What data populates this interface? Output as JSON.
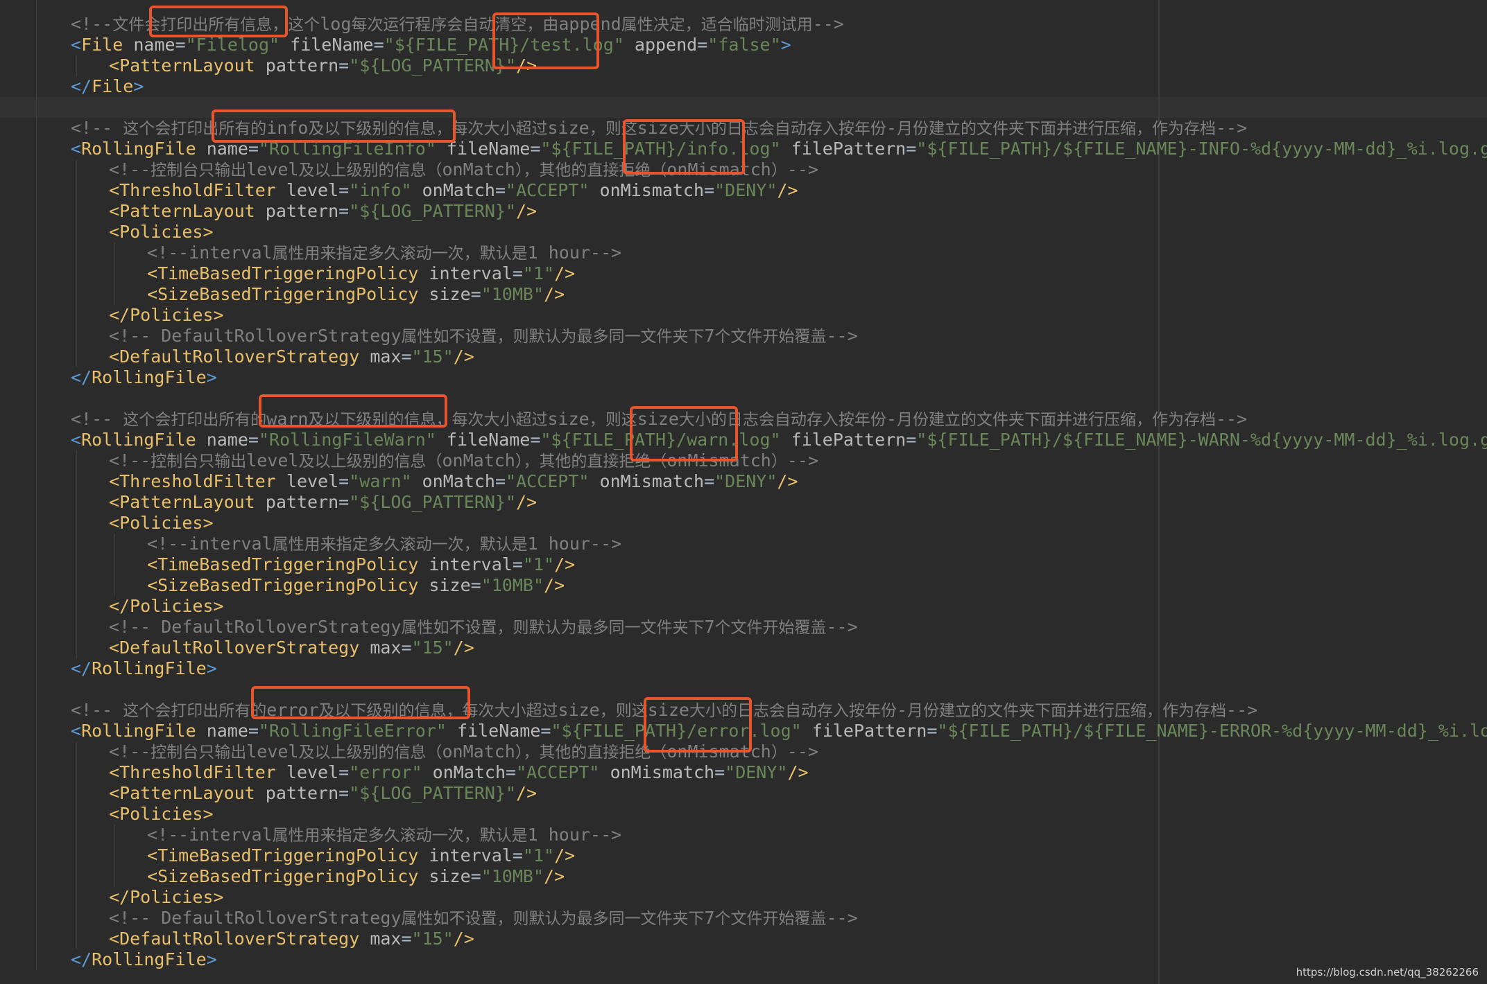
{
  "colors": {
    "background": "#2b2b2b",
    "comment": "#808080",
    "tag": "#e8bf6a",
    "attr_value": "#6a8759",
    "highlight": "#e8542c"
  },
  "code": {
    "lines": [
      {
        "kind": "comment",
        "indent": 0,
        "text": "<!--文件会打印出所有信息，这个log每次运行程序会自动清空，由append属性决定，适合临时测试用-->"
      },
      {
        "kind": "tag",
        "indent": 0,
        "text": "<File name=\"Filelog\" fileName=\"${FILE_PATH}/test.log\" append=\"false\">"
      },
      {
        "kind": "tag",
        "indent": 1,
        "text": "<PatternLayout pattern=\"${LOG_PATTERN}\"/>"
      },
      {
        "kind": "tag",
        "indent": 0,
        "text": "</File>"
      },
      {
        "kind": "blank",
        "indent": 0,
        "text": ""
      },
      {
        "kind": "comment",
        "indent": 0,
        "text": "<!-- 这个会打印出所有的info及以下级别的信息，每次大小超过size，则这size大小的日志会自动存入按年份-月份建立的文件夹下面并进行压缩，作为存档-->"
      },
      {
        "kind": "tag",
        "indent": 0,
        "text": "<RollingFile name=\"RollingFileInfo\" fileName=\"${FILE_PATH}/info.log\" filePattern=\"${FILE_PATH}/${FILE_NAME}-INFO-%d{yyyy-MM-dd}_%i.log.gz\">"
      },
      {
        "kind": "comment",
        "indent": 1,
        "text": "<!--控制台只输出level及以上级别的信息（onMatch），其他的直接拒绝（onMismatch）-->"
      },
      {
        "kind": "tag",
        "indent": 1,
        "text": "<ThresholdFilter level=\"info\" onMatch=\"ACCEPT\" onMismatch=\"DENY\"/>"
      },
      {
        "kind": "tag",
        "indent": 1,
        "text": "<PatternLayout pattern=\"${LOG_PATTERN}\"/>"
      },
      {
        "kind": "tag",
        "indent": 1,
        "text": "<Policies>"
      },
      {
        "kind": "comment",
        "indent": 2,
        "text": "<!--interval属性用来指定多久滚动一次，默认是1 hour-->"
      },
      {
        "kind": "tag",
        "indent": 2,
        "text": "<TimeBasedTriggeringPolicy interval=\"1\"/>"
      },
      {
        "kind": "tag",
        "indent": 2,
        "text": "<SizeBasedTriggeringPolicy size=\"10MB\"/>"
      },
      {
        "kind": "tag",
        "indent": 1,
        "text": "</Policies>"
      },
      {
        "kind": "comment",
        "indent": 1,
        "text": "<!-- DefaultRolloverStrategy属性如不设置，则默认为最多同一文件夹下7个文件开始覆盖-->"
      },
      {
        "kind": "tag",
        "indent": 1,
        "text": "<DefaultRolloverStrategy max=\"15\"/>"
      },
      {
        "kind": "tag",
        "indent": 0,
        "text": "</RollingFile>"
      },
      {
        "kind": "blank",
        "indent": 0,
        "text": ""
      },
      {
        "kind": "comment",
        "indent": 0,
        "text": "<!-- 这个会打印出所有的warn及以下级别的信息，每次大小超过size，则这size大小的日志会自动存入按年份-月份建立的文件夹下面并进行压缩，作为存档-->"
      },
      {
        "kind": "tag",
        "indent": 0,
        "text": "<RollingFile name=\"RollingFileWarn\" fileName=\"${FILE_PATH}/warn.log\" filePattern=\"${FILE_PATH}/${FILE_NAME}-WARN-%d{yyyy-MM-dd}_%i.log.gz\">"
      },
      {
        "kind": "comment",
        "indent": 1,
        "text": "<!--控制台只输出level及以上级别的信息（onMatch），其他的直接拒绝（onMismatch）-->"
      },
      {
        "kind": "tag",
        "indent": 1,
        "text": "<ThresholdFilter level=\"warn\" onMatch=\"ACCEPT\" onMismatch=\"DENY\"/>"
      },
      {
        "kind": "tag",
        "indent": 1,
        "text": "<PatternLayout pattern=\"${LOG_PATTERN}\"/>"
      },
      {
        "kind": "tag",
        "indent": 1,
        "text": "<Policies>"
      },
      {
        "kind": "comment",
        "indent": 2,
        "text": "<!--interval属性用来指定多久滚动一次，默认是1 hour-->"
      },
      {
        "kind": "tag",
        "indent": 2,
        "text": "<TimeBasedTriggeringPolicy interval=\"1\"/>"
      },
      {
        "kind": "tag",
        "indent": 2,
        "text": "<SizeBasedTriggeringPolicy size=\"10MB\"/>"
      },
      {
        "kind": "tag",
        "indent": 1,
        "text": "</Policies>"
      },
      {
        "kind": "comment",
        "indent": 1,
        "text": "<!-- DefaultRolloverStrategy属性如不设置，则默认为最多同一文件夹下7个文件开始覆盖-->"
      },
      {
        "kind": "tag",
        "indent": 1,
        "text": "<DefaultRolloverStrategy max=\"15\"/>"
      },
      {
        "kind": "tag",
        "indent": 0,
        "text": "</RollingFile>"
      },
      {
        "kind": "blank",
        "indent": 0,
        "text": ""
      },
      {
        "kind": "comment",
        "indent": 0,
        "text": "<!-- 这个会打印出所有的error及以下级别的信息，每次大小超过size，则这size大小的日志会自动存入按年份-月份建立的文件夹下面并进行压缩，作为存档-->"
      },
      {
        "kind": "tag",
        "indent": 0,
        "text": "<RollingFile name=\"RollingFileError\" fileName=\"${FILE_PATH}/error.log\" filePattern=\"${FILE_PATH}/${FILE_NAME}-ERROR-%d{yyyy-MM-dd}_%i.log.gz\">"
      },
      {
        "kind": "comment",
        "indent": 1,
        "text": "<!--控制台只输出level及以上级别的信息（onMatch），其他的直接拒绝（onMismatch）-->"
      },
      {
        "kind": "tag",
        "indent": 1,
        "text": "<ThresholdFilter level=\"error\" onMatch=\"ACCEPT\" onMismatch=\"DENY\"/>"
      },
      {
        "kind": "tag",
        "indent": 1,
        "text": "<PatternLayout pattern=\"${LOG_PATTERN}\"/>"
      },
      {
        "kind": "tag",
        "indent": 1,
        "text": "<Policies>"
      },
      {
        "kind": "comment",
        "indent": 2,
        "text": "<!--interval属性用来指定多久滚动一次，默认是1 hour-->"
      },
      {
        "kind": "tag",
        "indent": 2,
        "text": "<TimeBasedTriggeringPolicy interval=\"1\"/>"
      },
      {
        "kind": "tag",
        "indent": 2,
        "text": "<SizeBasedTriggeringPolicy size=\"10MB\"/>"
      },
      {
        "kind": "tag",
        "indent": 1,
        "text": "</Policies>"
      },
      {
        "kind": "comment",
        "indent": 1,
        "text": "<!-- DefaultRolloverStrategy属性如不设置，则默认为最多同一文件夹下7个文件开始覆盖-->"
      },
      {
        "kind": "tag",
        "indent": 1,
        "text": "<DefaultRolloverStrategy max=\"15\"/>"
      },
      {
        "kind": "tag",
        "indent": 0,
        "text": "</RollingFile>"
      }
    ]
  },
  "watermark": "https://blog.csdn.net/qq_38262266"
}
